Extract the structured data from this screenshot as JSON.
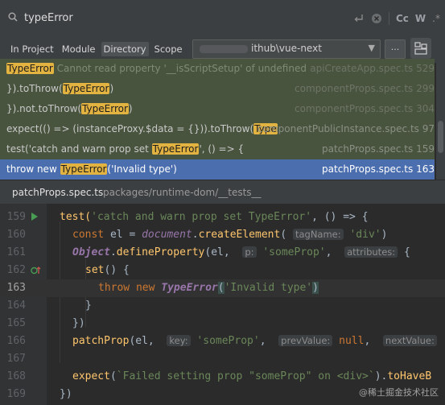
{
  "search": {
    "query": "typeError",
    "tools": [
      "Cc",
      "W",
      ".*"
    ]
  },
  "scope": {
    "tabs": [
      {
        "label": "In Project",
        "active": false
      },
      {
        "label": "Module",
        "active": false
      },
      {
        "label": "Directory",
        "active": true
      },
      {
        "label": "Scope",
        "active": false
      }
    ],
    "directory": "ithub\\vue-next",
    "browse_label": "..."
  },
  "results": [
    {
      "pre": "",
      "match": "TypeError",
      "post": " Cannot read property '__isScriptSetup' of undefined",
      "file": "apiCreateApp.spec.ts 529",
      "selected": false
    },
    {
      "pre": "}).toThrow(",
      "match": "TypeError",
      "post": ")",
      "file": "componentProps.spec.ts 299",
      "selected": false
    },
    {
      "pre": "}).not.toThrow(",
      "match": "TypeError",
      "post": ")",
      "file": "componentProps.spec.ts 304",
      "selected": false
    },
    {
      "pre": "expect(() => (instanceProxy.$data = {})).toThrow(",
      "match": "Type",
      "post": "",
      "file": "componentPublicInstance.spec.ts 97",
      "selected": false
    },
    {
      "pre": "test('catch and warn prop set ",
      "match": "TypeError",
      "post": "', () => {",
      "file": "patchProps.spec.ts 159",
      "selected": false
    },
    {
      "pre": "throw new ",
      "match": "TypeError",
      "post": "('Invalid type')",
      "file": "patchProps.spec.ts 163",
      "selected": true
    }
  ],
  "preview": {
    "file": "patchProps.spec.ts",
    "path": "packages/runtime-dom/__tests__"
  },
  "code": {
    "line_numbers": [
      "159",
      "160",
      "161",
      "162",
      "163",
      "164",
      "165",
      "166",
      "167",
      "168",
      "169"
    ],
    "current_line": "163",
    "l159_a": "test(",
    "l159_s": "'catch and warn prop set TypeError'",
    "l159_b": ", () => {",
    "l160_kw": "const",
    "l160_a": " el = ",
    "l160_doc": "document",
    "l160_b": ".",
    "l160_fn": "createElement",
    "l160_c": "( ",
    "l160_hint": "tagName:",
    "l160_s": " 'div'",
    "l160_d": ")",
    "l161_obj": "Object",
    "l161_a": ".",
    "l161_fn": "defineProperty",
    "l161_b": "(el,  ",
    "l161_hint1": "p:",
    "l161_s": " 'someProp'",
    "l161_c": ",  ",
    "l161_hint2": "attributes:",
    "l161_d": " {",
    "l162_fn": "set",
    "l162_a": "() {",
    "l163_kw": "throw new",
    "l163_cls": "TypeError",
    "l163_p1": "(",
    "l163_s": "'Invalid type'",
    "l163_p2": ")",
    "l164": "}",
    "l165": "})",
    "l166_fn": "patchProp",
    "l166_a": "(el,  ",
    "l166_hint1": "key:",
    "l166_s": " 'someProp'",
    "l166_b": ",  ",
    "l166_hint2": "prevValue:",
    "l166_kw": " null",
    "l166_c": ",  ",
    "l166_hint3": "nextValue:",
    "l168_fn": "expect",
    "l168_a": "(",
    "l168_s": "`Failed setting prop \"someProp\" on <div>`",
    "l168_b": ").",
    "l168_fn2": "toHaveB",
    "l169": "})"
  },
  "watermark": "@稀土掘金技术社区",
  "colors": {
    "match_highlight": "#e3b341",
    "selected_row": "#4b6eaf",
    "row_bg": "#49543f"
  }
}
